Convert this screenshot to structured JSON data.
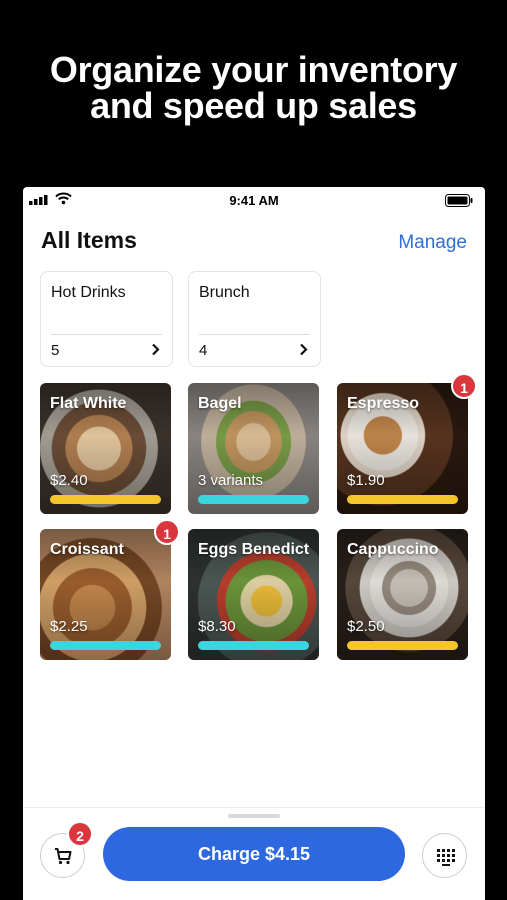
{
  "headline": {
    "line1": "Organize your inventory",
    "line2": "and speed up sales"
  },
  "status": {
    "time": "9:41 AM"
  },
  "header": {
    "title": "All Items",
    "manage": "Manage"
  },
  "categories": [
    {
      "name": "Hot Drinks",
      "count": "5"
    },
    {
      "name": "Brunch",
      "count": "4"
    }
  ],
  "items": [
    {
      "name": "Flat White",
      "detail": "$2.40",
      "color": "#f4c62a",
      "badge": ""
    },
    {
      "name": "Bagel",
      "detail": "3 variants",
      "color": "#3ad6de",
      "badge": ""
    },
    {
      "name": "Espresso",
      "detail": "$1.90",
      "color": "#f4c62a",
      "badge": "1"
    },
    {
      "name": "Croissant",
      "detail": "$2.25",
      "color": "#3ad6de",
      "badge": "1"
    },
    {
      "name": "Eggs Benedict",
      "detail": "$8.30",
      "color": "#3ad6de",
      "badge": ""
    },
    {
      "name": "Cappuccino",
      "detail": "$2.50",
      "color": "#f4c62a",
      "badge": ""
    }
  ],
  "cart": {
    "count": "2"
  },
  "charge": {
    "label": "Charge $4.15"
  },
  "icons": {
    "cart": "cart-icon",
    "keypad": "keypad-icon",
    "chevron": "chevron-right-icon"
  }
}
